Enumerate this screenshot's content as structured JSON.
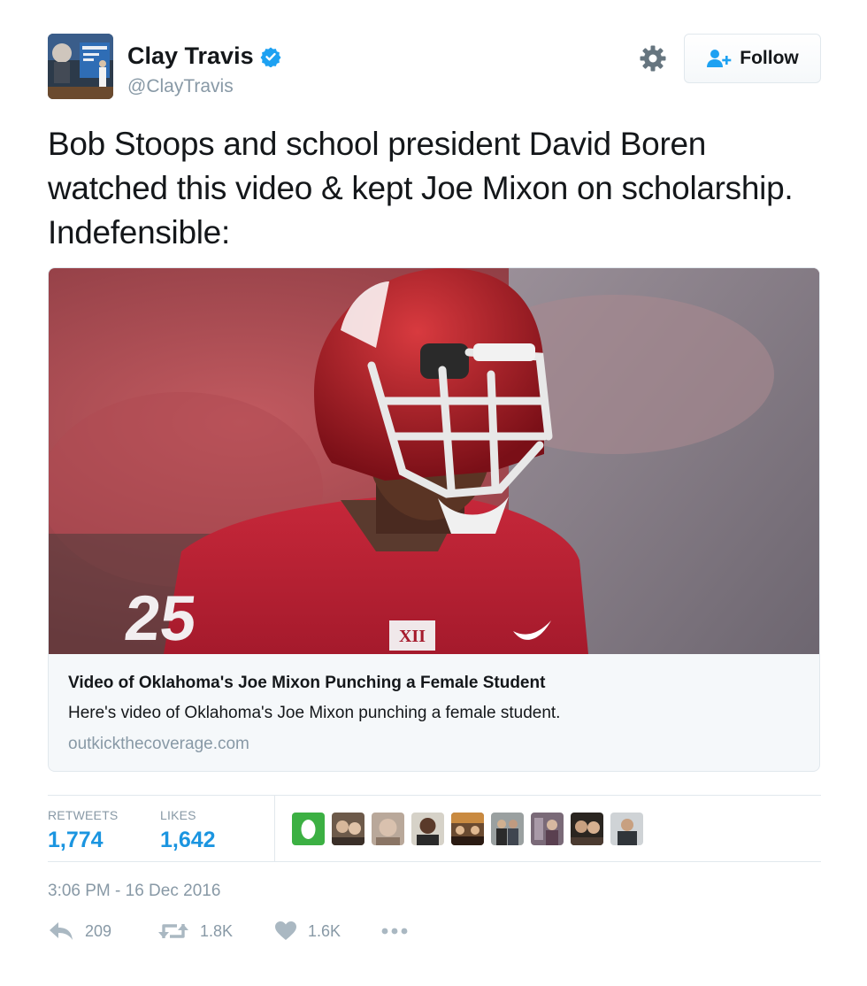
{
  "author": {
    "display_name": "Clay Travis",
    "handle": "@ClayTravis",
    "verified": true
  },
  "follow_button": {
    "label": "Follow"
  },
  "tweet": {
    "text": "Bob Stoops and school president David Boren watched this video & kept Joe Mixon on scholarship. Indefensible:"
  },
  "card": {
    "title": "Video of Oklahoma's Joe Mixon Punching a Female Student",
    "description": "Here's video of Oklahoma's Joe Mixon punching a female student.",
    "domain": "outkickthecoverage.com",
    "image_text": {
      "jersey_number": "25",
      "conference_logo": "XII"
    }
  },
  "stats": {
    "retweets_label": "RETWEETS",
    "retweets_value": "1,774",
    "likes_label": "LIKES",
    "likes_value": "1,642"
  },
  "timestamp": "3:06 PM - 16 Dec 2016",
  "actions": {
    "reply_count": "209",
    "retweet_count": "1.8K",
    "like_count": "1.6K"
  },
  "colors": {
    "accent": "#1b95e0",
    "muted": "#8899a6",
    "verified": "#1da1f2",
    "border": "#e1e8ed"
  }
}
